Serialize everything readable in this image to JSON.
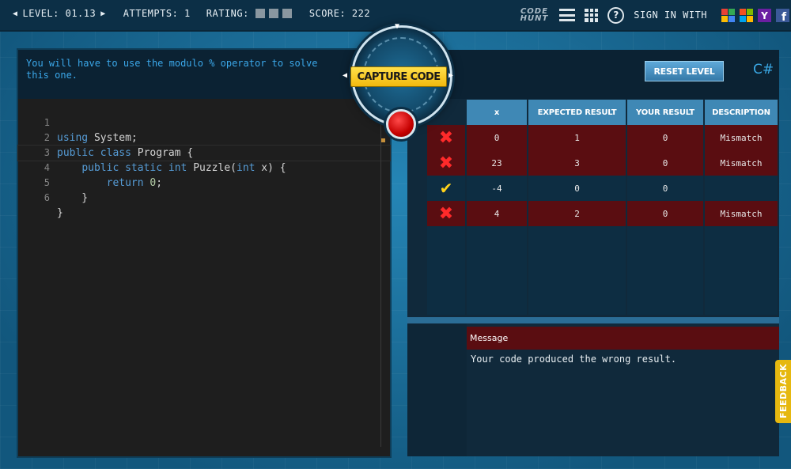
{
  "topbar": {
    "level_label": "LEVEL: 01.13",
    "attempts_label": "ATTEMPTS: 1",
    "rating_label": "RATING:",
    "score_label": "SCORE: 222",
    "logo_line1": "CODE",
    "logo_line2": "HUNT",
    "sign_in_label": "SIGN IN WITH"
  },
  "hint": "You will have to use the modulo % operator to solve this one.",
  "capture_label": "CAPTURE CODE",
  "reset_label": "RESET LEVEL",
  "language": "C#",
  "code": {
    "active_line": 4,
    "lines": [
      {
        "n": "1",
        "text": "using System;"
      },
      {
        "n": "2",
        "text": "public class Program {"
      },
      {
        "n": "3",
        "text": "    public static int Puzzle(int x) {"
      },
      {
        "n": "4",
        "text": "        return 0;"
      },
      {
        "n": "5",
        "text": "    }"
      },
      {
        "n": "6",
        "text": "}"
      }
    ]
  },
  "results": {
    "headers": [
      "x",
      "EXPECTED RESULT",
      "YOUR RESULT",
      "DESCRIPTION"
    ],
    "rows": [
      {
        "status": "fail",
        "x": "0",
        "expected": "1",
        "yours": "0",
        "description": "Mismatch"
      },
      {
        "status": "fail",
        "x": "23",
        "expected": "3",
        "yours": "0",
        "description": "Mismatch"
      },
      {
        "status": "pass",
        "x": "-4",
        "expected": "0",
        "yours": "0",
        "description": ""
      },
      {
        "status": "fail",
        "x": "4",
        "expected": "2",
        "yours": "0",
        "description": "Mismatch"
      }
    ]
  },
  "message": {
    "title": "Message",
    "body": "Your code produced the wrong result."
  },
  "feedback_label": "FEEDBACK",
  "colors": {
    "fail_row": "#5a0d11",
    "accent": "#3ba8ea",
    "capture": "#f2b90e"
  }
}
